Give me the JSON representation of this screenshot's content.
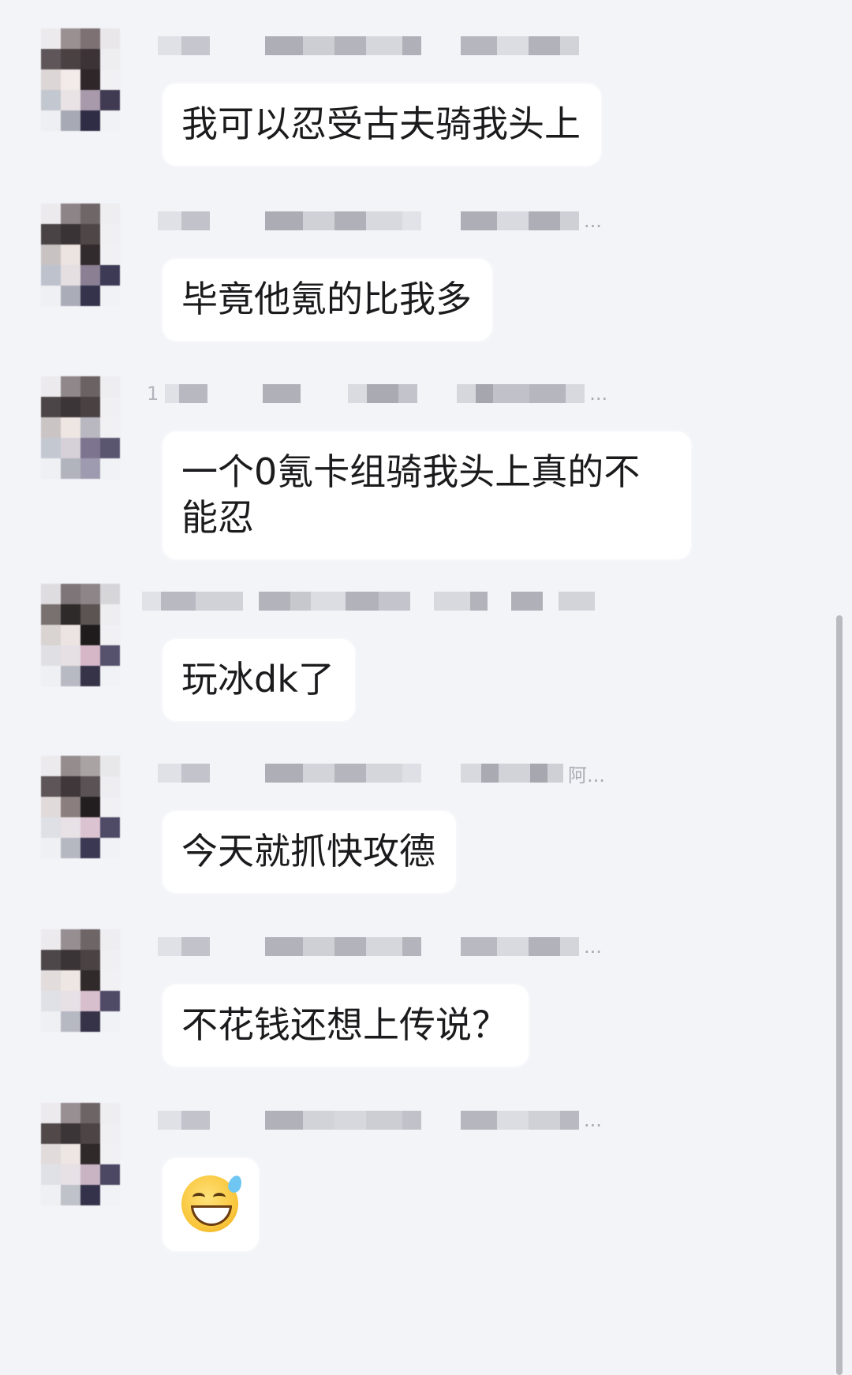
{
  "messages": [
    {
      "text": "我可以忍受古夫骑我头上",
      "sender_suffix": ""
    },
    {
      "text": "毕竟他氪的比我多",
      "sender_suffix": "..."
    },
    {
      "text": "一个0氪卡组骑我头上真的不能忍",
      "sender_suffix": "...",
      "sender_prefix": "1"
    },
    {
      "text": "玩冰dk了",
      "sender_suffix": ""
    },
    {
      "text": "今天就抓快攻德",
      "sender_suffix": "阿..."
    },
    {
      "text": "不花钱还想上传说？",
      "sender_suffix": "..."
    },
    {
      "emoji": "grinning-face-with-sweat",
      "sender_suffix": "..."
    }
  ],
  "colors": {
    "background": "#f3f4f8",
    "bubble": "#ffffff",
    "text": "#1b1b1d"
  }
}
